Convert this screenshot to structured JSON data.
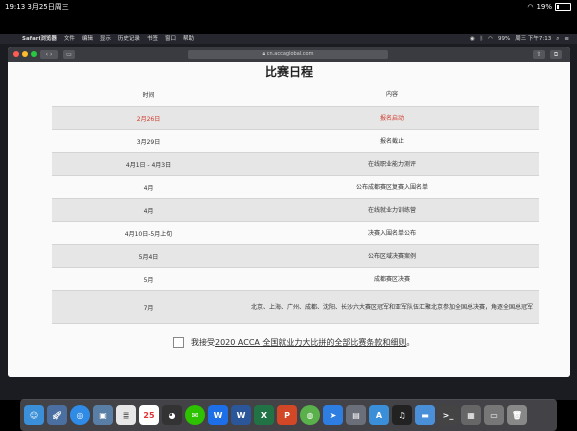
{
  "ipad_status": {
    "time_date": "19:13  3月25日周三",
    "battery": "19%"
  },
  "menubar": {
    "app_name": "Safari浏览器",
    "menus": [
      "文件",
      "编辑",
      "显示",
      "历史记录",
      "书签",
      "窗口",
      "帮助"
    ],
    "status_text": "99%",
    "clock": "周三 下午7:13"
  },
  "browser": {
    "url": "cn.accaglobal.com"
  },
  "page": {
    "title": "比赛日程",
    "columns": [
      "时间",
      "内容"
    ],
    "rows": [
      {
        "time": "2月26日",
        "content": "报名启动"
      },
      {
        "time": "3月29日",
        "content": "报名截止"
      },
      {
        "time": "4月1日 - 4月3日",
        "content": "在线职业能力测评"
      },
      {
        "time": "4月",
        "content": "公布成都赛区复赛入围名单"
      },
      {
        "time": "4月",
        "content": "在线就业力训练营"
      },
      {
        "time": "4月10日-5月上旬",
        "content": "决赛入围名单公布"
      },
      {
        "time": "5月4日",
        "content": "公布区域决赛案例"
      },
      {
        "time": "5月",
        "content": "成都赛区决赛"
      },
      {
        "time": "7月",
        "content": "北京、上海、广州、成都、沈阳、长沙六大赛区冠军和亚军队伍汇聚北京参加全国总决赛，角逐全国总冠军"
      }
    ],
    "agree_prefix": "我接受",
    "agree_link": "2020 ACCA 全国就业力大比拼的全部比赛条款和细则",
    "agree_suffix": "。"
  }
}
